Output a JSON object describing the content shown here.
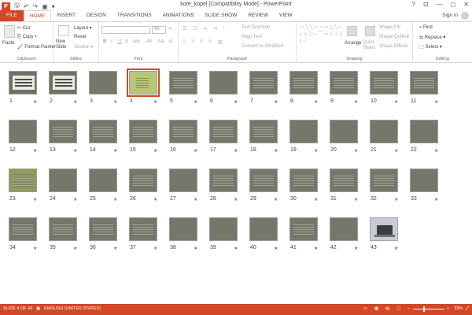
{
  "title_bar": {
    "title": "kore_kopel [Compatibility Mode] - PowerPoint",
    "app_badge": "P",
    "controls": [
      "?",
      "⊡",
      "—",
      "◻",
      "✕"
    ]
  },
  "tabs": [
    "FILE",
    "HOME",
    "INSERT",
    "DESIGN",
    "TRANSITIONS",
    "ANIMATIONS",
    "SLIDE SHOW",
    "REVIEW",
    "VIEW"
  ],
  "active_tab": "HOME",
  "sign_in": "Sign in",
  "ribbon": {
    "clipboard": {
      "label": "Clipboard",
      "paste": "Paste",
      "cut": "Cut",
      "copy": "Copy",
      "format_painter": "Format Painter"
    },
    "slides": {
      "label": "Slides",
      "new_slide": "New Slide",
      "layout": "Layout",
      "reset": "Reset",
      "section": "Section"
    },
    "font": {
      "label": "Font",
      "font_name": "",
      "font_size": "96"
    },
    "paragraph": {
      "label": "Paragraph",
      "text_direction": "Text Direction",
      "align_text": "Align Text",
      "convert": "Convert to SmartArt"
    },
    "drawing": {
      "label": "Drawing",
      "arrange": "Arrange",
      "quick_styles": "Quick Styles",
      "shape_fill": "Shape Fill",
      "shape_outline": "Shape Outline",
      "shape_effects": "Shape Effects"
    },
    "editing": {
      "label": "Editing",
      "find": "Find",
      "replace": "Replace",
      "select": "Select"
    }
  },
  "slides": [
    {
      "n": "1",
      "kind": "title"
    },
    {
      "n": "2",
      "kind": "title"
    },
    {
      "n": "3",
      "kind": "plain"
    },
    {
      "n": "4",
      "kind": "highlight"
    },
    {
      "n": "5",
      "kind": "text"
    },
    {
      "n": "6",
      "kind": "plain"
    },
    {
      "n": "7",
      "kind": "text"
    },
    {
      "n": "8",
      "kind": "text"
    },
    {
      "n": "9",
      "kind": "text"
    },
    {
      "n": "10",
      "kind": "text"
    },
    {
      "n": "11",
      "kind": "text"
    },
    {
      "n": "12",
      "kind": "plain"
    },
    {
      "n": "13",
      "kind": "text"
    },
    {
      "n": "14",
      "kind": "text"
    },
    {
      "n": "15",
      "kind": "text"
    },
    {
      "n": "16",
      "kind": "text"
    },
    {
      "n": "17",
      "kind": "text"
    },
    {
      "n": "18",
      "kind": "text"
    },
    {
      "n": "19",
      "kind": "plain"
    },
    {
      "n": "20",
      "kind": "plain"
    },
    {
      "n": "21",
      "kind": "plain"
    },
    {
      "n": "22",
      "kind": "plain"
    },
    {
      "n": "23",
      "kind": "green"
    },
    {
      "n": "24",
      "kind": "plain"
    },
    {
      "n": "25",
      "kind": "plain"
    },
    {
      "n": "26",
      "kind": "text"
    },
    {
      "n": "27",
      "kind": "plain"
    },
    {
      "n": "28",
      "kind": "text"
    },
    {
      "n": "29",
      "kind": "text"
    },
    {
      "n": "30",
      "kind": "text"
    },
    {
      "n": "31",
      "kind": "text"
    },
    {
      "n": "32",
      "kind": "text"
    },
    {
      "n": "33",
      "kind": "plain"
    },
    {
      "n": "34",
      "kind": "text"
    },
    {
      "n": "35",
      "kind": "text"
    },
    {
      "n": "36",
      "kind": "text"
    },
    {
      "n": "37",
      "kind": "text"
    },
    {
      "n": "38",
      "kind": "plain"
    },
    {
      "n": "39",
      "kind": "plain"
    },
    {
      "n": "40",
      "kind": "plain"
    },
    {
      "n": "41",
      "kind": "text"
    },
    {
      "n": "42",
      "kind": "plain"
    },
    {
      "n": "43",
      "kind": "photo"
    }
  ],
  "selected_slide": "4",
  "status": {
    "slide_info": "SLIDE 4 OF 43",
    "language": "ENGLISH (UNITED STATES)",
    "zoom": "33%",
    "zoom_fraction": 0.33
  },
  "colors": {
    "accent": "#d24726",
    "slide_bg": "#75776a"
  }
}
